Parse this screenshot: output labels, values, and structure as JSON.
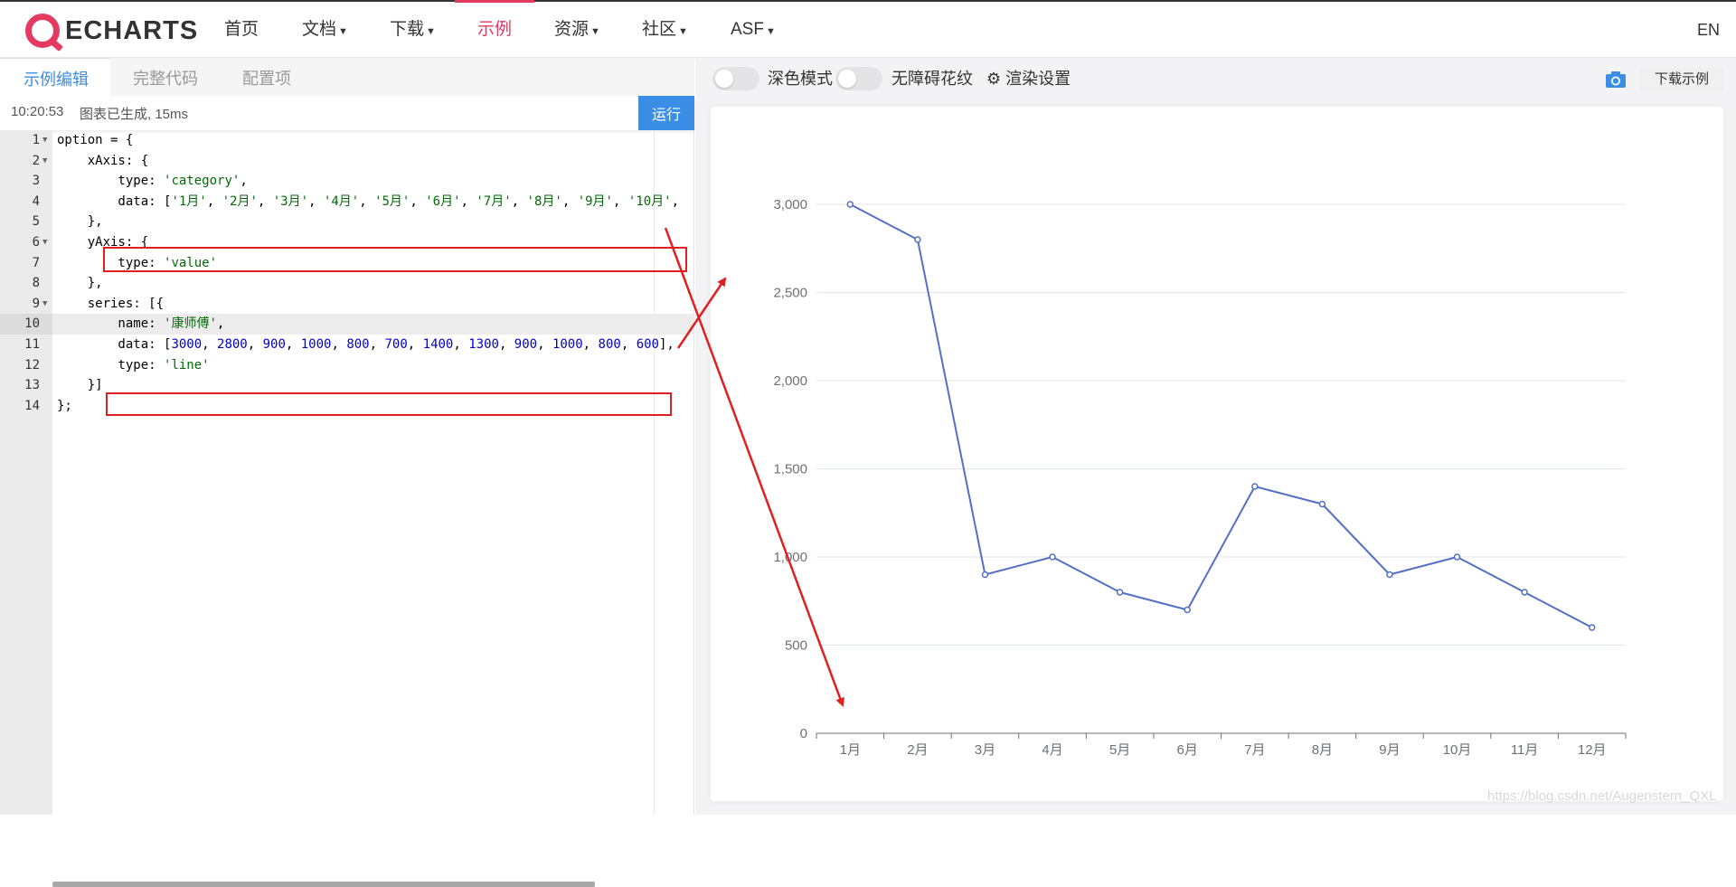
{
  "nav": {
    "logo_text": "ECHARTS",
    "items": [
      {
        "label": "首页",
        "has_caret": false
      },
      {
        "label": "文档",
        "has_caret": true
      },
      {
        "label": "下载",
        "has_caret": true
      },
      {
        "label": "示例",
        "has_caret": false,
        "active": true
      },
      {
        "label": "资源",
        "has_caret": true
      },
      {
        "label": "社区",
        "has_caret": true
      },
      {
        "label": "ASF",
        "has_caret": true
      }
    ],
    "lang": "EN",
    "accent_color": "#e43961"
  },
  "editor": {
    "tabs": [
      "示例编辑",
      "完整代码",
      "配置项"
    ],
    "status_time": "10:20:53",
    "status_message": "图表已生成, 15ms",
    "run_label": "运行",
    "current_line": 10,
    "lines": [
      "option = {",
      "    xAxis: {",
      "        type: 'category',",
      "        data: ['1月', '2月', '3月', '4月', '5月', '6月', '7月', '8月', '9月', '10月',",
      "    },",
      "    yAxis: {",
      "        type: 'value'",
      "    },",
      "    series: [{",
      "        name: '康师傅',",
      "        data: [3000, 2800, 900, 1000, 800, 700, 1400, 1300, 900, 1000, 800, 600],",
      "        type: 'line'",
      "    }]",
      "};"
    ]
  },
  "preview": {
    "dark_mode_label": "深色模式",
    "decal_label": "无障碍花纹",
    "render_settings_label": "渲染设置",
    "download_label": "下载示例"
  },
  "watermark": "https://blog.csdn.net/Augenstern_QXL",
  "chart_data": {
    "type": "line",
    "categories": [
      "1月",
      "2月",
      "3月",
      "4月",
      "5月",
      "6月",
      "7月",
      "8月",
      "9月",
      "10月",
      "11月",
      "12月"
    ],
    "series": [
      {
        "values": [
          3000,
          2800,
          900,
          1000,
          800,
          700,
          1400,
          1300,
          900,
          1000,
          800,
          600
        ],
        "color": "#5470c6"
      }
    ],
    "yticks": [
      "0",
      "500",
      "1,000",
      "1,500",
      "2,000",
      "2,500",
      "3,000"
    ],
    "ylim": [
      0,
      3000
    ],
    "grid": true,
    "title": "",
    "xlabel": "",
    "ylabel": ""
  }
}
